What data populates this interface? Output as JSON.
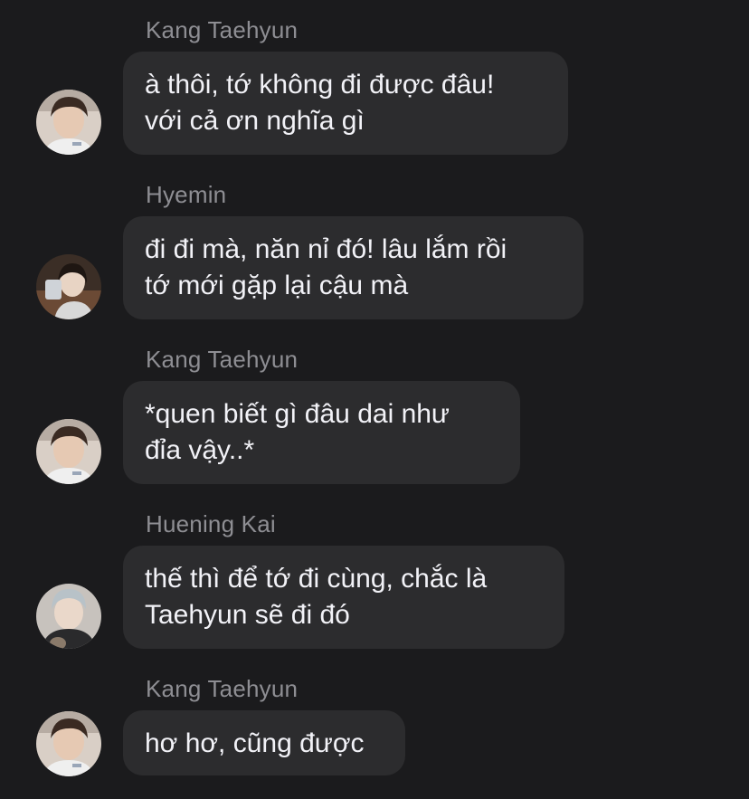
{
  "messages": [
    {
      "sender": "Kang Taehyun",
      "lines": [
        "à thôi, tớ không đi được đâu!",
        "với cả ơn nghĩa gì"
      ],
      "avatar_icon": "taehyun-avatar"
    },
    {
      "sender": "Hyemin",
      "lines": [
        "đi đi mà, năn nỉ đó! lâu lắm rồi",
        "tớ mới gặp lại cậu mà"
      ],
      "avatar_icon": "hyemin-avatar"
    },
    {
      "sender": "Kang Taehyun",
      "lines": [
        "*quen biết gì đâu dai như",
        "đỉa vậy..*"
      ],
      "avatar_icon": "taehyun-avatar"
    },
    {
      "sender": "Huening Kai",
      "lines": [
        "thế thì để tớ đi cùng, chắc là",
        "Taehyun sẽ đi đó"
      ],
      "avatar_icon": "hueningkai-avatar"
    },
    {
      "sender": "Kang Taehyun",
      "lines": [
        "hơ hơ, cũng được"
      ],
      "avatar_icon": "taehyun-avatar"
    }
  ],
  "colors": {
    "background": "#1b1b1d",
    "bubble": "#2c2c2e",
    "sender_text": "#8e8e93",
    "message_text": "#f2f2f7"
  }
}
